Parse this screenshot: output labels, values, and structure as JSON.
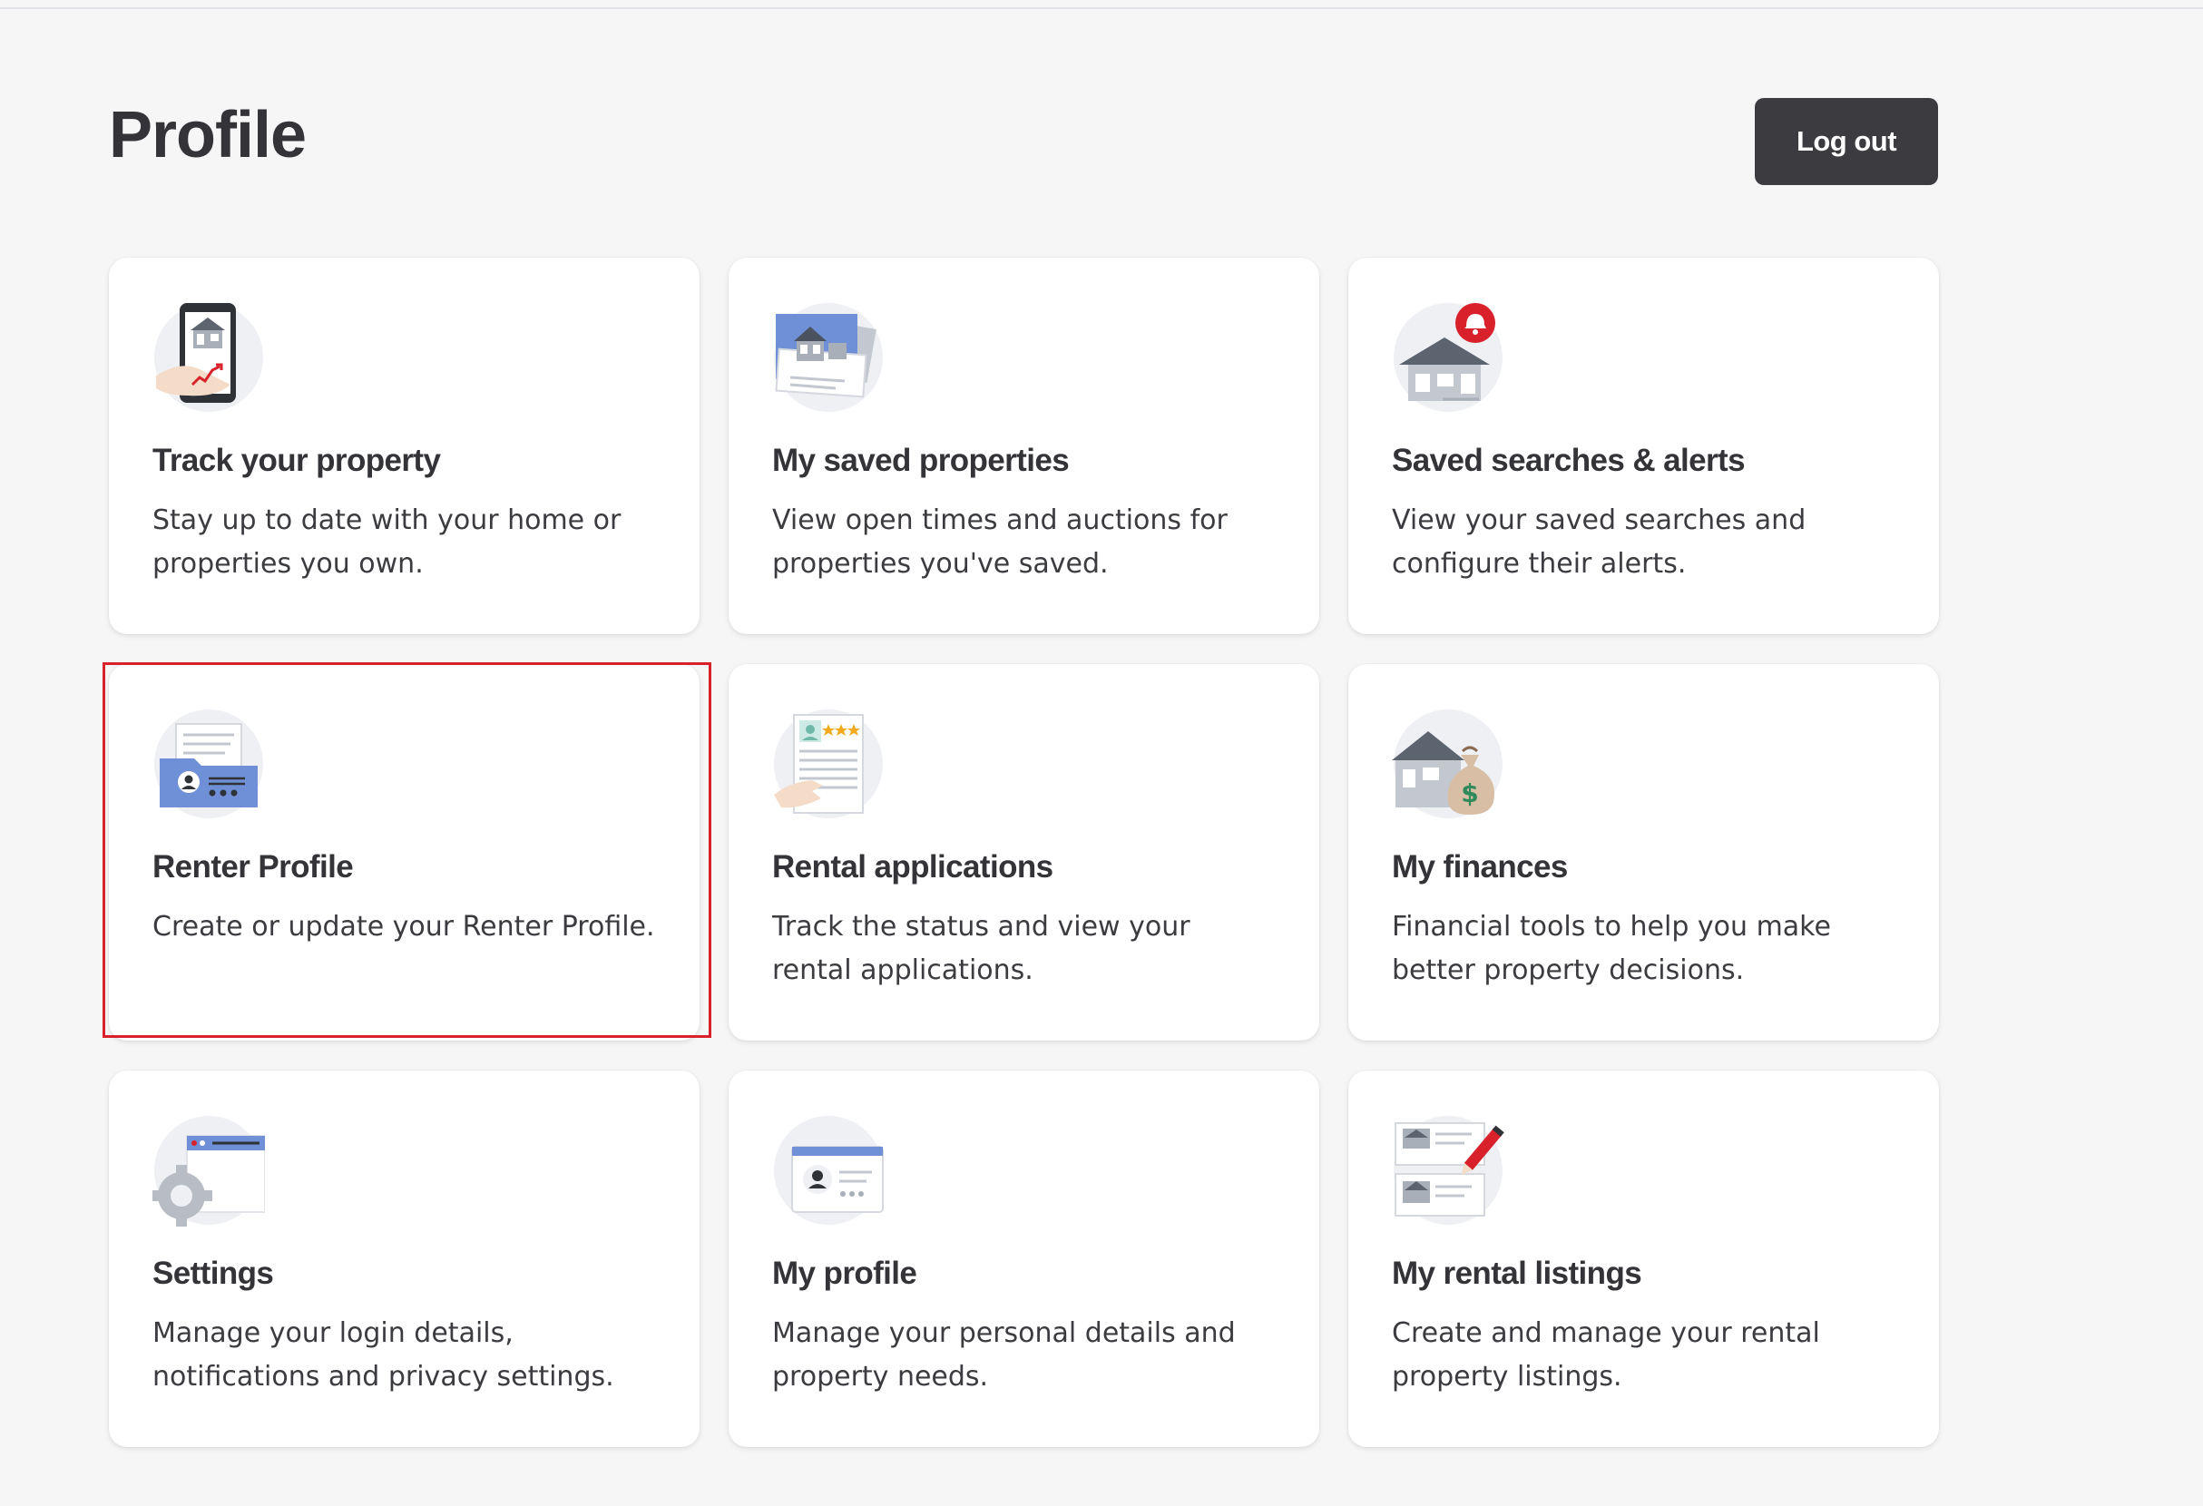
{
  "header": {
    "title": "Profile",
    "logout_label": "Log out"
  },
  "cards": [
    {
      "title": "Track your property",
      "desc": "Stay up to date with your home or properties you own.",
      "icon": "tracking-phone-icon"
    },
    {
      "title": "My saved properties",
      "desc": "View open times and auctions for properties you've saved.",
      "icon": "saved-properties-icon"
    },
    {
      "title": "Saved searches & alerts",
      "desc": "View your saved searches and configure their alerts.",
      "icon": "house-alert-icon"
    },
    {
      "title": "Renter Profile",
      "desc": "Create or update your Renter Profile.",
      "icon": "renter-folder-icon"
    },
    {
      "title": "Rental applications",
      "desc": "Track the status and view your rental applications.",
      "icon": "application-document-icon"
    },
    {
      "title": "My finances",
      "desc": "Financial tools to help you make better property decisions.",
      "icon": "house-money-icon"
    },
    {
      "title": "Settings",
      "desc": "Manage your login details, notifications and privacy settings.",
      "icon": "settings-gear-icon"
    },
    {
      "title": "My profile",
      "desc": "Manage your personal details and property needs.",
      "icon": "profile-card-icon"
    },
    {
      "title": "My rental listings",
      "desc": "Create and manage your rental property listings.",
      "icon": "listing-edit-icon"
    }
  ],
  "colors": {
    "accent_red": "#d8212b",
    "button_dark": "#3b3b40",
    "illustration_blue": "#6f8fd6",
    "illustration_gray": "#5c6470"
  }
}
